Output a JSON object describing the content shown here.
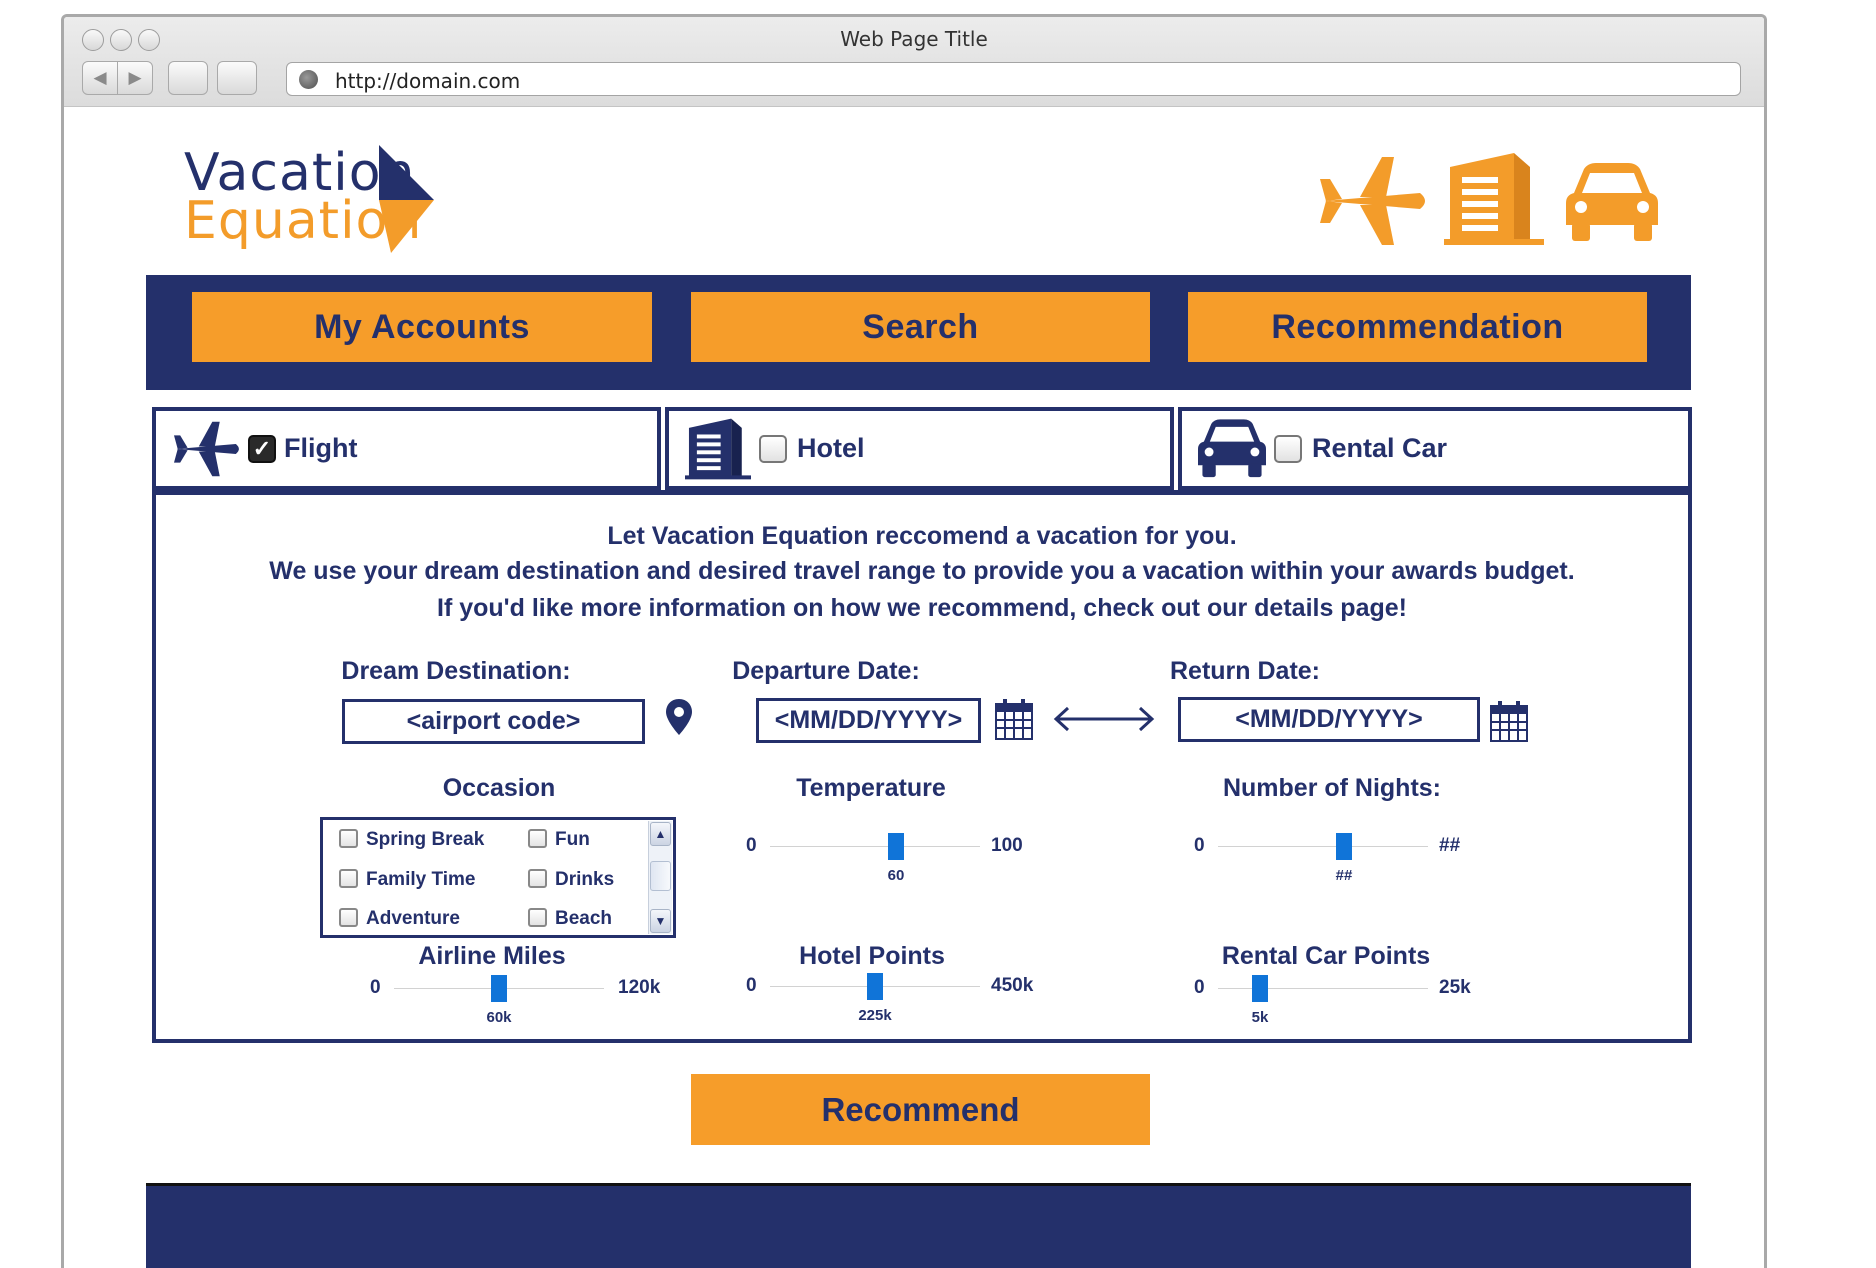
{
  "window": {
    "title": "Web Page Title",
    "url": "http://domain.com"
  },
  "logo": {
    "line1": "Vacation",
    "line2": "Equation"
  },
  "header_icons": [
    "airplane-icon",
    "hotel-building-icon",
    "car-icon"
  ],
  "nav": {
    "tabs": [
      "My Accounts",
      "Search",
      "Recommendation"
    ]
  },
  "categories": [
    {
      "label": "Flight",
      "checked": true,
      "icon": "airplane-icon"
    },
    {
      "label": "Hotel",
      "checked": false,
      "icon": "hotel-building-icon"
    },
    {
      "label": "Rental Car",
      "checked": false,
      "icon": "car-icon"
    }
  ],
  "intro": {
    "line1": "Let Vacation Equation reccomend a vacation for you.",
    "line2": "We use your dream destination and desired travel range to provide you a vacation within your awards budget.",
    "line3": "If you'd like more information on how we recommend, check out our details page!"
  },
  "form": {
    "destination": {
      "label": "Dream Destination:",
      "value": "<airport code>"
    },
    "departure": {
      "label": "Departure Date:",
      "value": "<MM/DD/YYYY>"
    },
    "return": {
      "label": "Return Date:",
      "value": "<MM/DD/YYYY>"
    },
    "occasion": {
      "label": "Occasion",
      "options": [
        "Spring Break",
        "Fun",
        "Family Time",
        "Drinks",
        "Adventure",
        "Beach"
      ]
    },
    "temperature": {
      "label": "Temperature",
      "min": "0",
      "max": "100",
      "value": "60",
      "fraction": 0.6
    },
    "nights": {
      "label": "Number of Nights:",
      "min": "0",
      "max": "##",
      "value": "##",
      "fraction": 0.6
    },
    "airline_miles": {
      "label": "Airline Miles",
      "min": "0",
      "max": "120k",
      "value": "60k",
      "fraction": 0.5
    },
    "hotel_points": {
      "label": "Hotel Points",
      "min": "0",
      "max": "450k",
      "value": "225k",
      "fraction": 0.5
    },
    "car_points": {
      "label": "Rental Car Points",
      "min": "0",
      "max": "25k",
      "value": "5k",
      "fraction": 0.2
    }
  },
  "recommend_button": "Recommend",
  "colors": {
    "navy": "#24306b",
    "orange": "#f69d2a",
    "slider_thumb": "#1074d8"
  }
}
